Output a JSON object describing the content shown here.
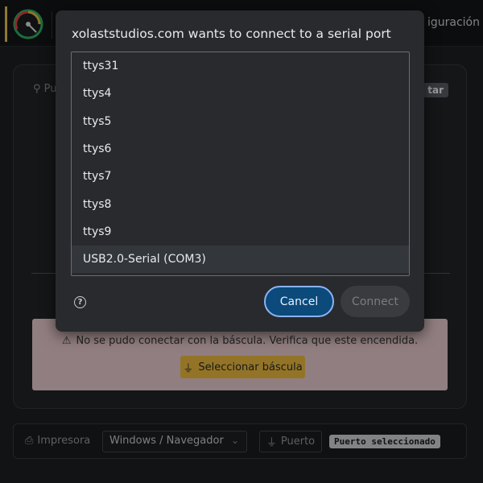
{
  "app": {
    "nav": {
      "config_label": "iguración"
    },
    "scale": {
      "port_label": "Pu",
      "connect_label": "tar",
      "error_message": "No se pudo conectar con la báscula. Verifica que este encendida.",
      "select_button_label": "Seleccionar báscula"
    },
    "printer": {
      "label": "Impresora",
      "select_value": "Windows / Navegador",
      "port_button_label": "Puerto",
      "port_badge": "Puerto seleccionado"
    }
  },
  "dialog": {
    "title": "xolaststudios.com wants to connect to a serial port",
    "ports": [
      {
        "name": "ttys31"
      },
      {
        "name": "ttys4"
      },
      {
        "name": "ttys5"
      },
      {
        "name": "ttys6"
      },
      {
        "name": "ttys7"
      },
      {
        "name": "ttys8"
      },
      {
        "name": "ttys9"
      },
      {
        "name": "USB2.0-Serial (COM3)"
      }
    ],
    "selected_port": "USB2.0-Serial (COM3)",
    "cancel_label": "Cancel",
    "connect_label": "Connect",
    "help_glyph": "?"
  },
  "colors": {
    "accent_yellow": "#f5c242",
    "error_bg": "#f2d3d6",
    "dialog_primary": "#0b4a7a",
    "dialog_focus_ring": "#8ab4f8"
  },
  "icons": {
    "logo": "gauge-logo-icon",
    "port": "usb-plug-icon",
    "warning": "warning-triangle-icon",
    "printer": "printer-icon",
    "help": "help-circle-icon",
    "chevron": "chevron-down-icon"
  }
}
